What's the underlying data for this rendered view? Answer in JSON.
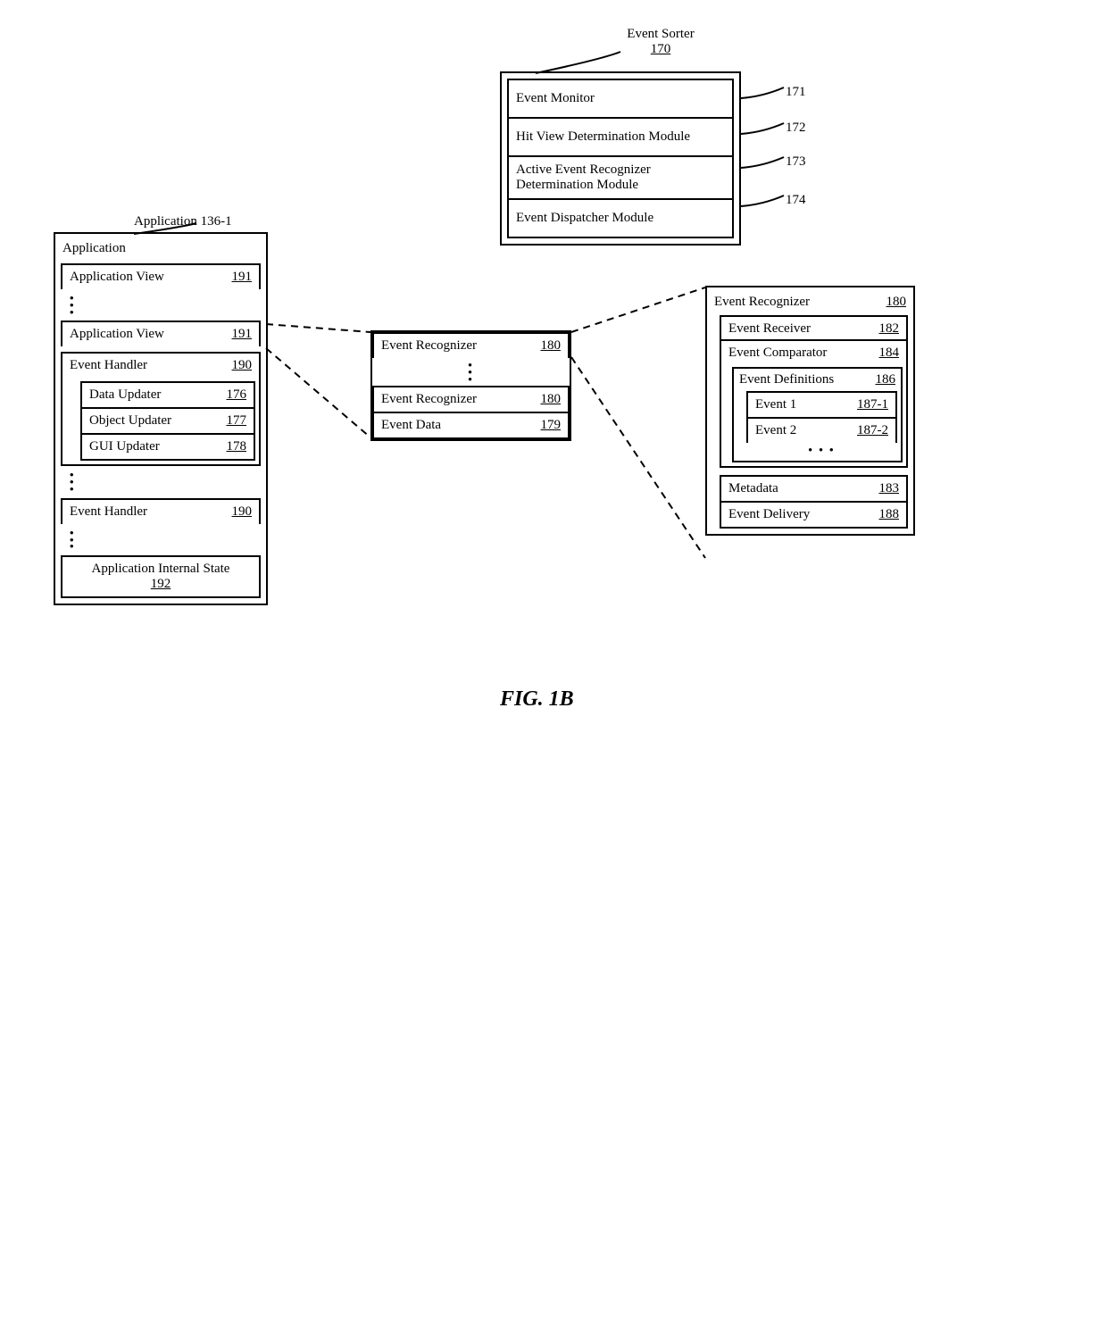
{
  "figure_label": "FIG. 1B",
  "application_label": "Application 136-1",
  "application": {
    "header": {
      "label": "Application"
    },
    "app_view_1": {
      "label": "Application View",
      "num": "191"
    },
    "app_view_2": {
      "label": "Application View",
      "num": "191"
    },
    "event_handler_1": {
      "label": "Event Handler",
      "num": "190"
    },
    "data_updater": {
      "label": "Data Updater",
      "num": "176"
    },
    "object_updater": {
      "label": "Object Updater",
      "num": "177"
    },
    "gui_updater": {
      "label": "GUI Updater",
      "num": "178"
    },
    "event_handler_2": {
      "label": "Event Handler",
      "num": "190"
    },
    "internal_state": {
      "label": "Application Internal State",
      "num": "192"
    }
  },
  "event_sorter_label": "Event Sorter",
  "event_sorter_num": "170",
  "event_sorter": {
    "monitor": {
      "label": "Event Monitor",
      "num": "171"
    },
    "hit_view": {
      "label": "Hit View Determination Module",
      "num": "172"
    },
    "active_rec": {
      "label": "Active Event Recognizer Determination Module",
      "num": "173"
    },
    "dispatcher": {
      "label": "Event Dispatcher Module",
      "num": "174"
    }
  },
  "app_view_expand": {
    "rec1": {
      "label": "Event Recognizer",
      "num": "180"
    },
    "rec2": {
      "label": "Event Recognizer",
      "num": "180"
    },
    "data": {
      "label": "Event Data",
      "num": "179"
    }
  },
  "recognizer": {
    "header": {
      "label": "Event Recognizer",
      "num": "180"
    },
    "receiver": {
      "label": "Event Receiver",
      "num": "182"
    },
    "comparator": {
      "label": "Event Comparator",
      "num": "184"
    },
    "definitions": {
      "label": "Event Definitions",
      "num": "186"
    },
    "event1": {
      "label": "Event 1",
      "num": "187-1"
    },
    "event2": {
      "label": "Event 2",
      "num": "187-2"
    },
    "metadata": {
      "label": "Metadata",
      "num": "183"
    },
    "delivery": {
      "label": "Event Delivery",
      "num": "188"
    }
  }
}
